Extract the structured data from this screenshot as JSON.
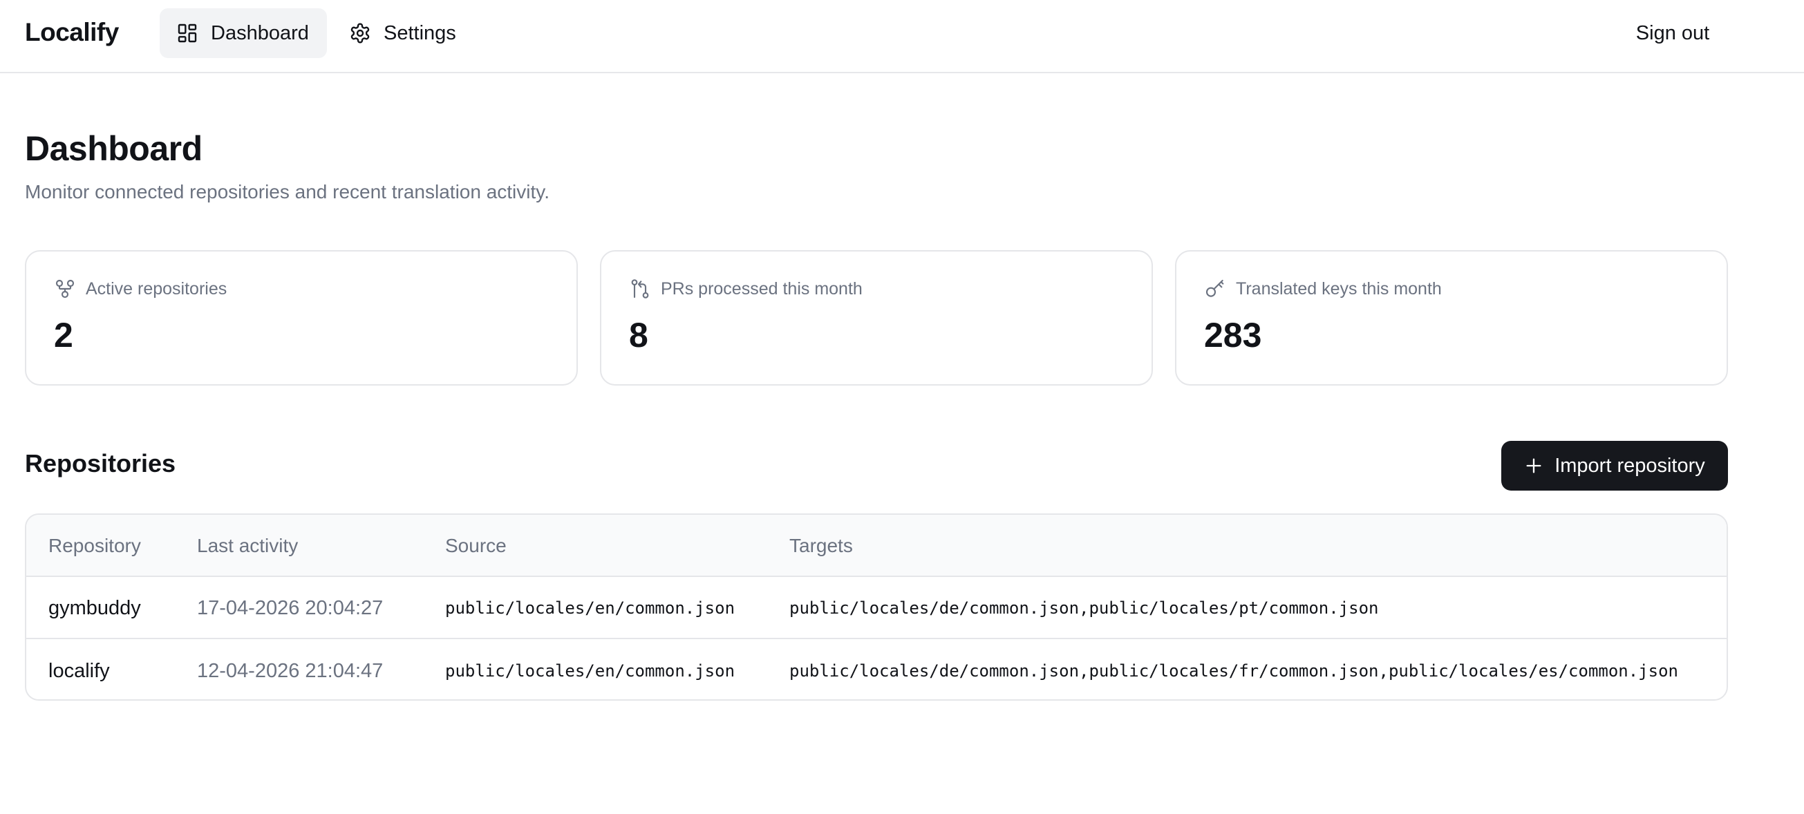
{
  "header": {
    "brand": "Localify",
    "nav": [
      {
        "label": "Dashboard",
        "icon": "dashboard-icon",
        "active": true
      },
      {
        "label": "Settings",
        "icon": "gear-icon",
        "active": false
      }
    ],
    "sign_out": "Sign out"
  },
  "page": {
    "title": "Dashboard",
    "subtitle": "Monitor connected repositories and recent translation activity."
  },
  "stats": [
    {
      "label": "Active repositories",
      "value": "2",
      "icon": "git-fork-icon"
    },
    {
      "label": "PRs processed this month",
      "value": "8",
      "icon": "git-pull-request-icon"
    },
    {
      "label": "Translated keys this month",
      "value": "283",
      "icon": "key-icon"
    }
  ],
  "repositories": {
    "title": "Repositories",
    "import_label": "Import repository",
    "columns": [
      "Repository",
      "Last activity",
      "Source",
      "Targets"
    ],
    "rows": [
      {
        "name": "gymbuddy",
        "last_activity": "17-04-2026 20:04:27",
        "source": "public/locales/en/common.json",
        "targets": "public/locales/de/common.json,public/locales/pt/common.json"
      },
      {
        "name": "localify",
        "last_activity": "12-04-2026 21:04:47",
        "source": "public/locales/en/common.json",
        "targets": "public/locales/de/common.json,public/locales/fr/common.json,public/locales/es/common.json"
      }
    ]
  },
  "colors": {
    "text": "#111318",
    "muted": "#6b7280",
    "border": "#e5e6e9",
    "primary_button": "#16181d",
    "active_nav": "#f2f3f5"
  }
}
